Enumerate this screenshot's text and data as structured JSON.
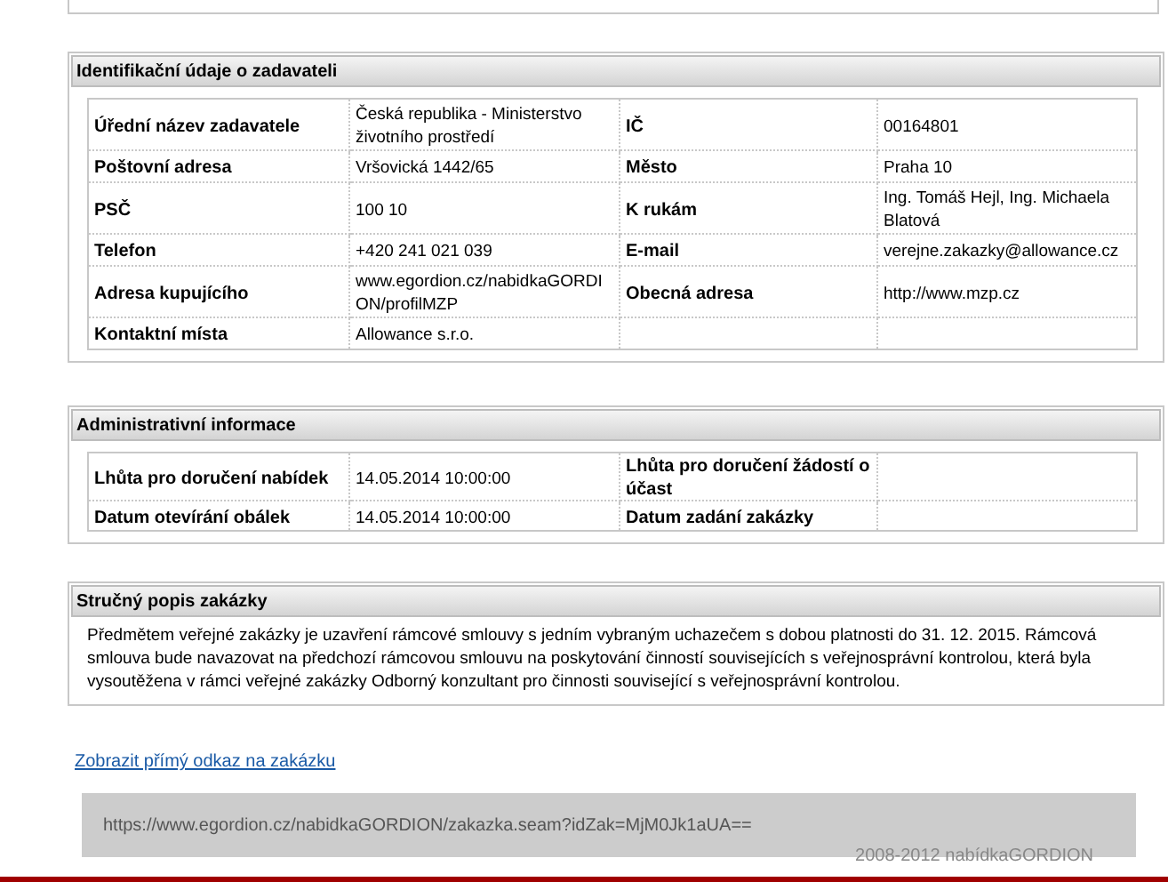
{
  "identification": {
    "title": "Identifikační údaje o zadavateli",
    "rows": [
      {
        "label_1": "Úřední název zadavatele",
        "value_1": "Česká republika - Ministerstvo životního prostředí",
        "label_2": "IČ",
        "value_2": "00164801"
      },
      {
        "label_1": "Poštovní adresa",
        "value_1": "Vršovická 1442/65",
        "label_2": "Město",
        "value_2": "Praha 10"
      },
      {
        "label_1": "PSČ",
        "value_1": "100 10",
        "label_2": "K rukám",
        "value_2": "Ing. Tomáš Hejl, Ing. Michaela Blatová"
      },
      {
        "label_1": "Telefon",
        "value_1": "+420 241 021 039",
        "label_2": "E-mail",
        "value_2": "verejne.zakazky@allowance.cz"
      },
      {
        "label_1": "Adresa kupujícího",
        "value_1": "www.egordion.cz/nabidkaGORDION/profilMZP",
        "label_2": "Obecná adresa",
        "value_2": "http://www.mzp.cz"
      },
      {
        "label_1": "Kontaktní místa",
        "value_1": "Allowance s.r.o."
      }
    ]
  },
  "administrative": {
    "title": "Administrativní informace",
    "rows": [
      {
        "label_1": "Lhůta pro doručení nabídek",
        "value_1": "14.05.2014 10:00:00",
        "label_2": "Lhůta pro doručení žádostí o účast"
      },
      {
        "label_1": "Datum otevírání obálek",
        "value_1": "14.05.2014 10:00:00",
        "label_2": "Datum zadání zakázky"
      }
    ]
  },
  "description": {
    "title": "Stručný popis zakázky",
    "text": "Předmětem veřejné zakázky je uzavření rámcové smlouvy s jedním vybraným uchazečem s dobou platnosti do 31. 12. 2015. Rámcová smlouva bude navazovat na předchozí rámcovou smlouvu na poskytování činností souvisejících s veřejnosprávní kontrolou, která byla vysoutěžena v rámci veřejné zakázky Odborný konzultant pro činnosti související s veřejnosprávní kontrolou."
  },
  "direct_link": {
    "label": "Zobrazit přímý odkaz na zakázku",
    "url": "https://www.egordion.cz/nabidkaGORDION/zakazka.seam?idZak=MjM0Jk1aUA=="
  },
  "footer": "2008-2012 nabídkaGORDION"
}
